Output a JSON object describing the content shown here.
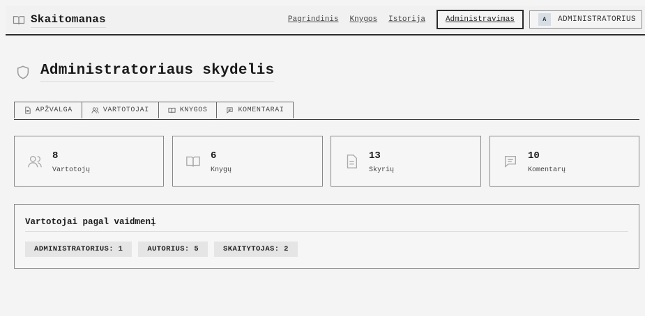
{
  "app": {
    "name": "Skaitomanas",
    "logo_icon": "book-icon"
  },
  "nav": {
    "items": [
      {
        "label": "Pagrindinis",
        "active": false
      },
      {
        "label": "Knygos",
        "active": false
      },
      {
        "label": "Istorija",
        "active": false
      },
      {
        "label": "Administravimas",
        "active": true
      }
    ],
    "user": {
      "initial": "A",
      "label": "ADMINISTRATORIUS"
    }
  },
  "page": {
    "title": "Administratoriaus skydelis",
    "icon": "shield-icon"
  },
  "tabs": [
    {
      "label": "APŽVALGA",
      "icon": "document-icon"
    },
    {
      "label": "VARTOTOJAI",
      "icon": "users-icon"
    },
    {
      "label": "KNYGOS",
      "icon": "book-icon"
    },
    {
      "label": "KOMENTARAI",
      "icon": "comment-icon"
    }
  ],
  "stats": [
    {
      "value": "8",
      "label": "Vartotojų",
      "icon": "users-icon"
    },
    {
      "value": "6",
      "label": "Knygų",
      "icon": "book-icon"
    },
    {
      "value": "13",
      "label": "Skyrių",
      "icon": "document-icon"
    },
    {
      "value": "10",
      "label": "Komentarų",
      "icon": "comment-icon"
    }
  ],
  "roles": {
    "title": "Vartotojai pagal vaidmenį",
    "chips": [
      "ADMINISTRATORIUS: 1",
      "AUTORIUS: 5",
      "SKAITYTOJAS: 2"
    ]
  },
  "colors": {
    "text": "#1a1a1a",
    "border": "#2b2b2b",
    "background": "#f4f4f4",
    "chip": "#e5e5e5",
    "avatar": "#d6dde4"
  }
}
